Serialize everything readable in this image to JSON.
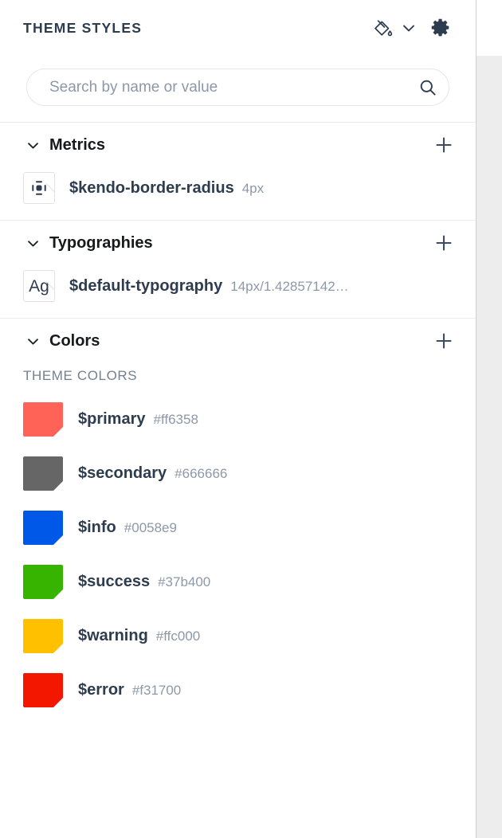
{
  "header": {
    "title": "THEME STYLES",
    "bucket_icon": "paint-bucket-icon",
    "chevron_icon": "chevron-down-icon",
    "gear_icon": "gear-icon"
  },
  "search": {
    "placeholder": "Search by name or value",
    "value": "",
    "icon": "search-icon"
  },
  "sections": {
    "metrics": {
      "title": "Metrics",
      "expanded": true,
      "add_label": "+",
      "items": [
        {
          "icon": "border-radius-icon",
          "name": "$kendo-border-radius",
          "value": "4px"
        }
      ]
    },
    "typographies": {
      "title": "Typographies",
      "expanded": true,
      "add_label": "+",
      "items": [
        {
          "icon": "typography-ag-icon",
          "preview": "Ag",
          "name": "$default-typography",
          "value": "14px/1.42857142…"
        }
      ]
    },
    "colors": {
      "title": "Colors",
      "expanded": true,
      "add_label": "+",
      "group_label": "THEME COLORS",
      "items": [
        {
          "name": "$primary",
          "value": "#ff6358",
          "color": "#ff6358"
        },
        {
          "name": "$secondary",
          "value": "#666666",
          "color": "#666666"
        },
        {
          "name": "$info",
          "value": "#0058e9",
          "color": "#0058e9"
        },
        {
          "name": "$success",
          "value": "#37b400",
          "color": "#37b400"
        },
        {
          "name": "$warning",
          "value": "#ffc000",
          "color": "#ffc000"
        },
        {
          "name": "$error",
          "value": "#f31700",
          "color": "#f31700"
        }
      ]
    }
  },
  "theme": {
    "text_color": "#2e3c4f",
    "muted_color": "#8d98a8",
    "panel_border": "#cfcfcf",
    "divider": "#ececec",
    "outside_background": "#ededed"
  }
}
